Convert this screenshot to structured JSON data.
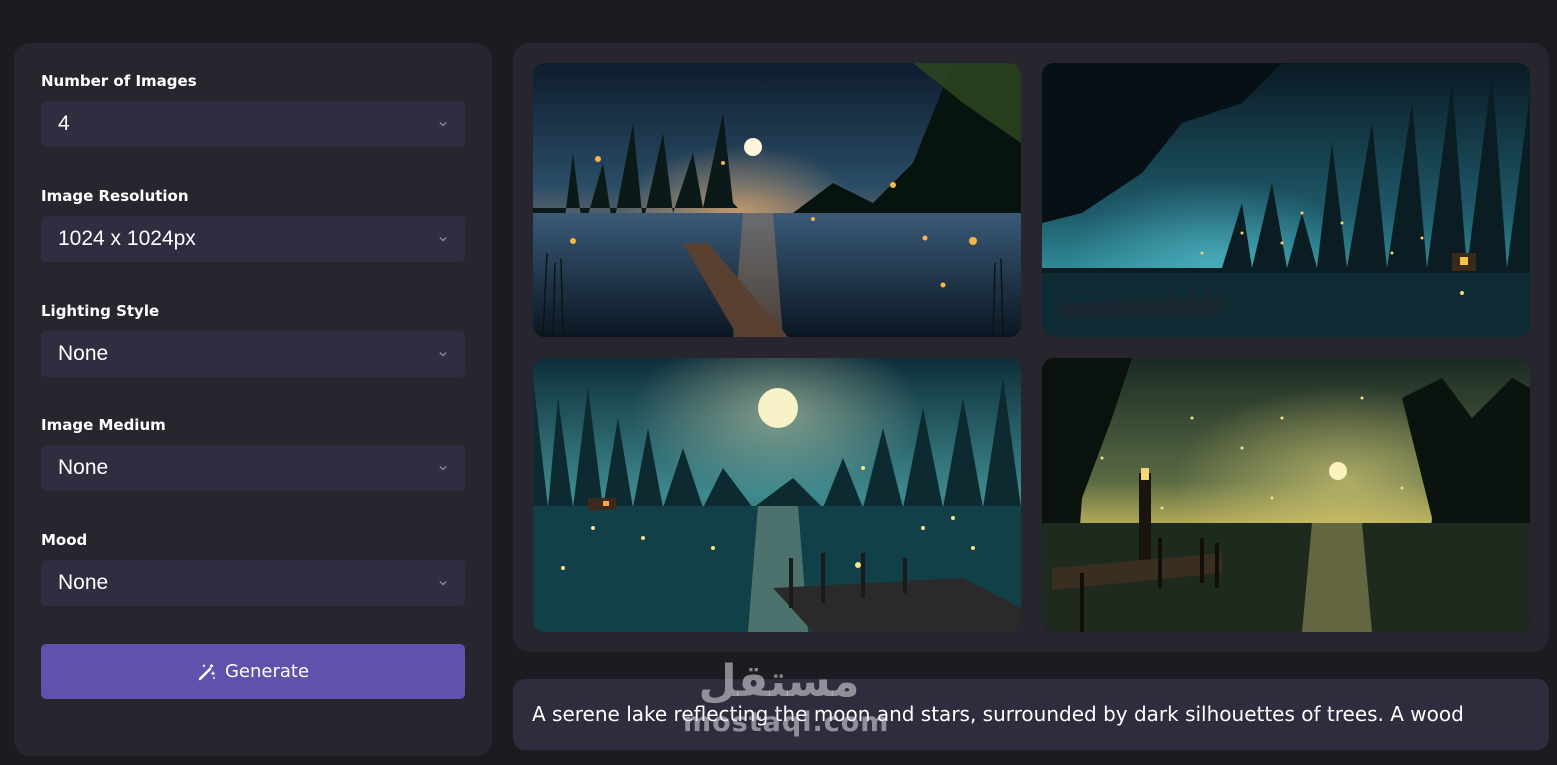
{
  "sidebar": {
    "fields": [
      {
        "label": "Number of Images",
        "value": "4"
      },
      {
        "label": "Image Resolution",
        "value": "1024 x 1024px"
      },
      {
        "label": "Lighting Style",
        "value": "None"
      },
      {
        "label": "Image Medium",
        "value": "None"
      },
      {
        "label": "Mood",
        "value": "None"
      }
    ],
    "generate_label": "Generate",
    "generate_icon": "magic-wand-icon"
  },
  "gallery": {
    "images": [
      {
        "name": "moonlit-lake-dock"
      },
      {
        "name": "teal-forest-lake-cabin"
      },
      {
        "name": "full-moon-lake-pier"
      },
      {
        "name": "golden-lantern-lake"
      }
    ]
  },
  "prompt": {
    "text": "A serene lake reflecting the moon and stars, surrounded by dark silhouettes of trees. A wood"
  },
  "watermark": {
    "arabic": "مستقل",
    "latin": "mostaql.com"
  },
  "colors": {
    "background": "#1b1b22",
    "panel": "#27262f",
    "select": "#322c40",
    "accent": "#5e52ac"
  }
}
